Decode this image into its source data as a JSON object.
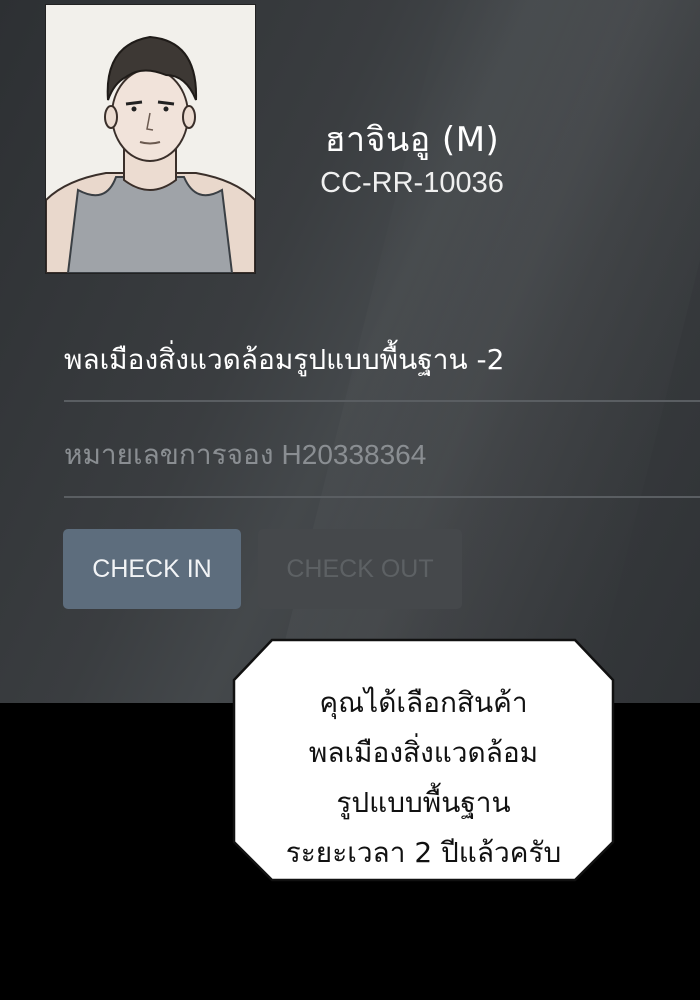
{
  "profile": {
    "name": "ฮาจินอู (M)",
    "code": "CC-RR-10036",
    "avatar_icon": "portrait-illustration"
  },
  "product_name": "พลเมืองสิ่งแวดล้อมรูปแบบพื้นฐาน -2",
  "reservation": {
    "label": "หมายเลขการจอง",
    "number": "H20338364"
  },
  "buttons": {
    "check_in": "CHECK IN",
    "check_out": "CHECK OUT"
  },
  "speech_bubble": {
    "lines": [
      "คุณได้เลือกสินค้า",
      "พลเมืองสิ่งแวดล้อม",
      "รูปแบบพื้นฐาน",
      "ระยะเวลา 2 ปีแล้วครับ"
    ]
  },
  "colors": {
    "check_in_bg": "#5d6d7d",
    "check_out_bg": "#45484b",
    "panel_bg": "#3a3d40"
  }
}
